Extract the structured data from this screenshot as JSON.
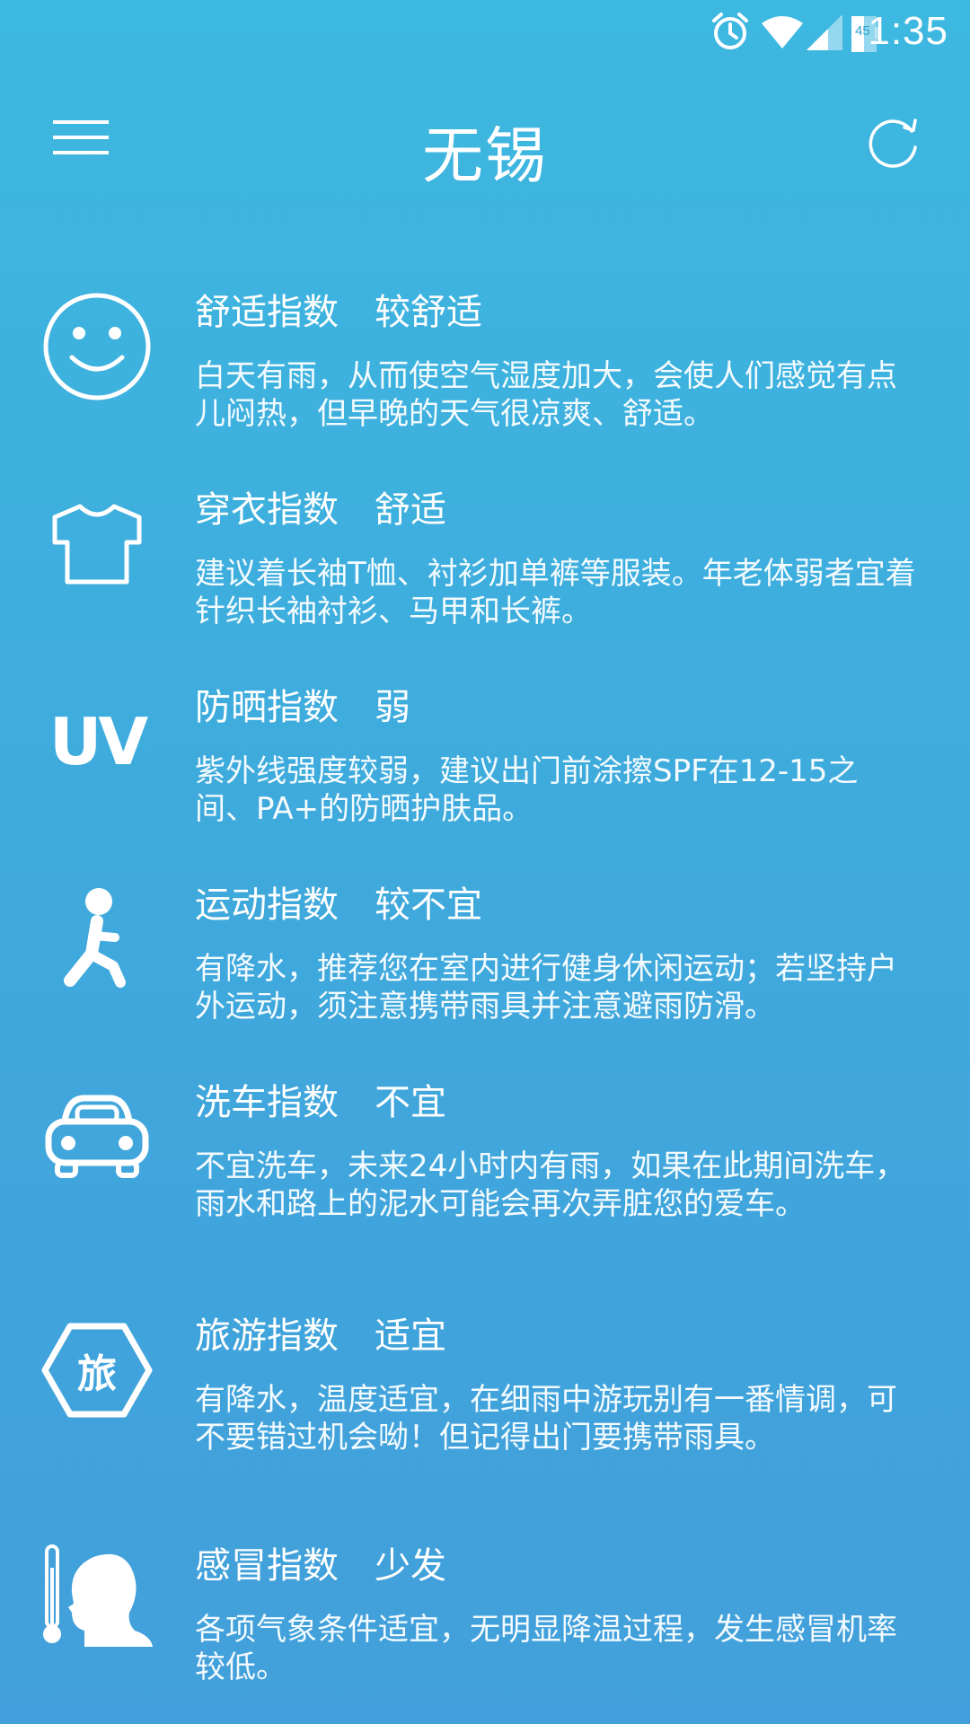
{
  "status_bar": {
    "time": "1:35",
    "battery_level": "45",
    "icons": [
      "alarm-icon",
      "wifi-icon",
      "cell-signal-icon",
      "battery-icon"
    ]
  },
  "app_bar": {
    "city": "无锡",
    "menu_icon": "hamburger-menu-icon",
    "refresh_icon": "refresh-icon"
  },
  "indices": [
    {
      "icon": "smiley-icon",
      "name": "舒适指数",
      "level": "较舒适",
      "desc": "白天有雨，从而使空气湿度加大，会使人们感觉有点儿闷热，但早晚的天气很凉爽、舒适。"
    },
    {
      "icon": "tshirt-icon",
      "name": "穿衣指数",
      "level": "舒适",
      "desc": "建议着长袖T恤、衬衫加单裤等服装。年老体弱者宜着针织长袖衬衫、马甲和长裤。"
    },
    {
      "icon": "uv-icon",
      "icon_text": "UV",
      "name": "防晒指数",
      "level": "弱",
      "desc": "紫外线强度较弱，建议出门前涂擦SPF在12-15之间、PA+的防晒护肤品。"
    },
    {
      "icon": "running-person-icon",
      "name": "运动指数",
      "level": "较不宜",
      "desc": "有降水，推荐您在室内进行健身休闲运动；若坚持户外运动，须注意携带雨具并注意避雨防滑。"
    },
    {
      "icon": "car-icon",
      "name": "洗车指数",
      "level": "不宜",
      "desc": "不宜洗车，未来24小时内有雨，如果在此期间洗车，雨水和路上的泥水可能会再次弄脏您的爱车。"
    },
    {
      "icon": "travel-hexagon-icon",
      "icon_text": "旅",
      "name": "旅游指数",
      "level": "适宜",
      "desc": "有降水，温度适宜，在细雨中游玩别有一番情调，可不要错过机会呦！但记得出门要携带雨具。"
    },
    {
      "icon": "thermometer-head-icon",
      "name": "感冒指数",
      "level": "少发",
      "desc": "各项气象条件适宜，无明显降温过程，发生感冒机率较低。"
    }
  ]
}
